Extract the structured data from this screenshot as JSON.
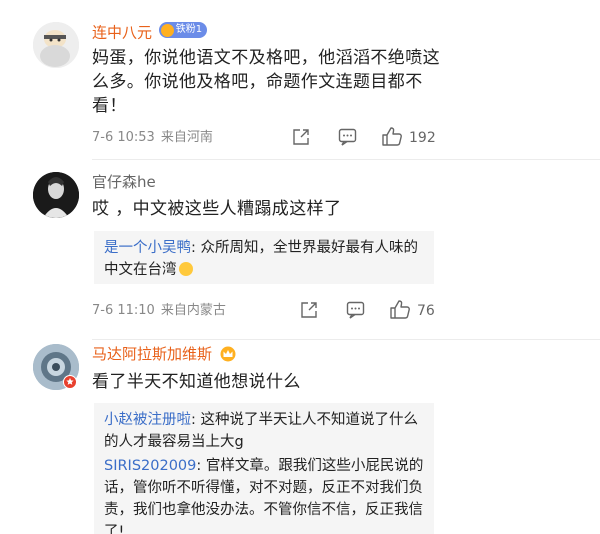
{
  "comments": [
    {
      "username": "连中八元",
      "fan_badge": "铁粉1",
      "text": "妈蛋，你说他语文不及格吧，他滔滔不绝喷这么多。你说他及格吧，命题作文连题目都不看！",
      "time": "7-6 10:53",
      "location": "来自河南",
      "likes": "192"
    },
    {
      "username": "官仔森he",
      "text": "哎 ，中文被这些人糟蹋成这样了",
      "replies": [
        {
          "name": "是一个小吴鸭",
          "text": ": 众所周知，全世界最好最有人味的中文在台湾"
        }
      ],
      "time": "7-6 11:10",
      "location": "来自内蒙古",
      "likes": "76"
    },
    {
      "username": "马达阿拉斯加维斯",
      "text": "看了半天不知道他想说什么",
      "replies": [
        {
          "name": "小赵被注册啦",
          "text": ": 这种说了半天让人不知道说了什么的人才最容易当上大g"
        },
        {
          "name": "SIRIS202009",
          "text": ": 官样文章。跟我们这些小屁民说的话，管你听不听得懂，对不对题，反正不对我们负责，我们也拿他没办法。不管你信不信，反正我信了!"
        }
      ]
    }
  ],
  "colors": {
    "orange_name": "#e8611a",
    "reply_name": "#3b6ec8"
  }
}
